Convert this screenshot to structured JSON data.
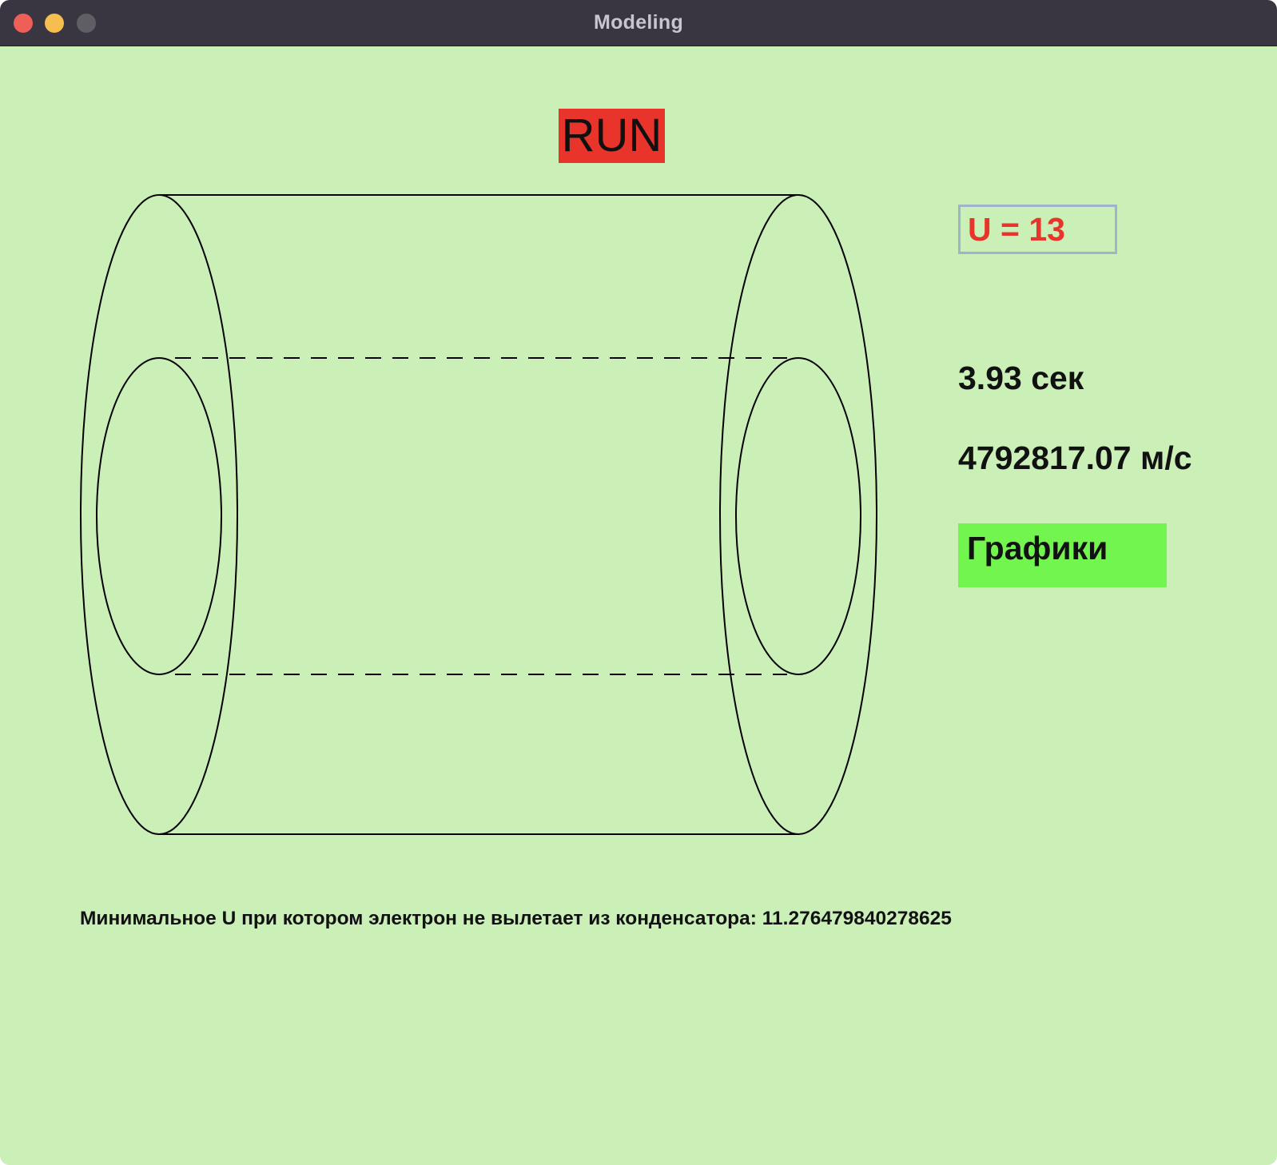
{
  "window": {
    "title": "Modeling",
    "background_color": "#cbf0b7",
    "titlebar_color": "#393641",
    "traffic_lights": [
      {
        "name": "close",
        "color": "#ee5f58"
      },
      {
        "name": "minimize",
        "color": "#f5be4f"
      },
      {
        "name": "maximize",
        "color": "#5f5e65"
      }
    ]
  },
  "controls": {
    "run_label": "RUN",
    "run_color": "#e8342b",
    "voltage_label": "U = 13",
    "voltage_text_color": "#e8342b",
    "charts_label": "Графики",
    "charts_color": "#72f54f"
  },
  "readouts": {
    "time": "3.93 сек",
    "speed": "4792817.07 м/с"
  },
  "footer": {
    "min_voltage_text": "Минимальное U при котором электрон не вылетает из конденсатора: 11.276479840278625"
  },
  "diagram": {
    "line_color": "#000000"
  }
}
